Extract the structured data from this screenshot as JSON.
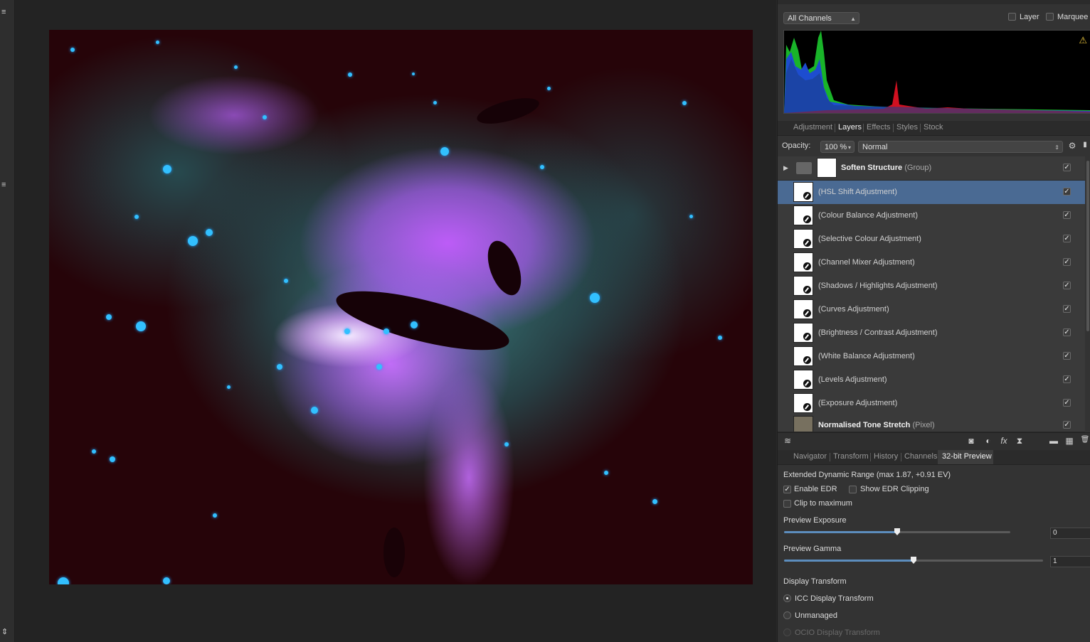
{
  "left_strip": {
    "menu_icon_glyph": "≡",
    "menu_icon2_glyph": "≡",
    "stepper_glyph": "⇕"
  },
  "histogram_panel": {
    "channel_select": "All Channels",
    "layer_label": "Layer",
    "marquee_label": "Marquee",
    "warning_glyph": "⚠"
  },
  "layers_panel": {
    "tabs": [
      "Adjustment",
      "Layers",
      "Effects",
      "Styles",
      "Stock"
    ],
    "active_tab": "Layers",
    "opacity_label": "Opacity:",
    "opacity_value": "100 %",
    "blend_mode": "Normal",
    "group": {
      "name": "Soften Structure",
      "type": "(Group)",
      "expand_glyph": "▶"
    },
    "layers": [
      {
        "name": "(HSL Shift Adjustment)",
        "selected": true
      },
      {
        "name": "(Colour Balance Adjustment)",
        "selected": false
      },
      {
        "name": "(Selective Colour Adjustment)",
        "selected": false
      },
      {
        "name": "(Channel Mixer Adjustment)",
        "selected": false
      },
      {
        "name": "(Shadows / Highlights Adjustment)",
        "selected": false
      },
      {
        "name": "(Curves Adjustment)",
        "selected": false
      },
      {
        "name": "(Brightness / Contrast Adjustment)",
        "selected": false
      },
      {
        "name": "(White Balance Adjustment)",
        "selected": false
      },
      {
        "name": "(Levels Adjustment)",
        "selected": false
      },
      {
        "name": "(Exposure Adjustment)",
        "selected": false
      }
    ],
    "pixel_layer": {
      "name": "Normalised Tone Stretch",
      "type": "(Pixel)"
    },
    "check_glyph": "✓",
    "footer_icons": {
      "layers": "≋",
      "mask": "◙",
      "adjust": "◐",
      "fx": "fx",
      "hourglass": "⧗",
      "folder": "▬",
      "checker": "▦",
      "trash": "🗑"
    }
  },
  "preview_panel": {
    "tabs": [
      "Navigator",
      "Transform",
      "History",
      "Channels",
      "32-bit Preview"
    ],
    "active_tab": "32-bit Preview",
    "edr_info": "Extended Dynamic Range (max 1.87, +0.91 EV)",
    "enable_edr": {
      "label": "Enable EDR",
      "checked": true
    },
    "show_edr_clipping": {
      "label": "Show EDR Clipping",
      "checked": false
    },
    "clip_to_maximum": {
      "label": "Clip to maximum",
      "checked": false
    },
    "preview_exposure": {
      "label": "Preview Exposure",
      "value": "0",
      "level": 0.5
    },
    "preview_gamma": {
      "label": "Preview Gamma",
      "value": "1",
      "level": 0.5
    },
    "display_transform_label": "Display Transform",
    "display_options": [
      {
        "label": "ICC Display Transform",
        "selected": true,
        "enabled": true
      },
      {
        "label": "Unmanaged",
        "selected": false,
        "enabled": true
      },
      {
        "label": "OCIO Display Transform",
        "selected": false,
        "enabled": false
      }
    ]
  }
}
